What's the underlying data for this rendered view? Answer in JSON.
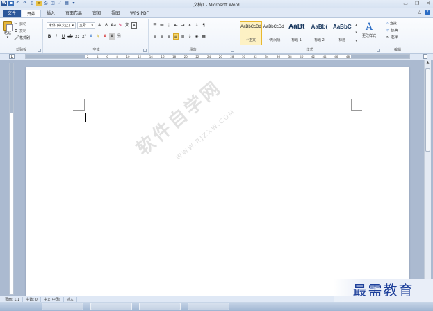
{
  "title_bar": {
    "title": "文档1 - Microsoft Word",
    "quick_access": [
      "save-icon",
      "undo-icon",
      "redo-icon",
      "new-doc-icon",
      "open-icon",
      "print-icon",
      "preview-icon",
      "spelling-icon",
      "draw-table-icon"
    ],
    "window_controls": [
      "minimize",
      "maximize",
      "close"
    ]
  },
  "tabs": [
    {
      "label": "文件"
    },
    {
      "label": "开始"
    },
    {
      "label": "插入"
    },
    {
      "label": "页面布局"
    },
    {
      "label": "审阅"
    },
    {
      "label": "视图"
    },
    {
      "label": "WPS PDF"
    }
  ],
  "clipboard": {
    "paste": "粘贴",
    "cut": "剪切",
    "copy": "复制",
    "format_painter": "格式刷",
    "label": "剪贴板"
  },
  "font": {
    "family": "宋体 (中文正)",
    "size": "五号",
    "label": "字体"
  },
  "paragraph": {
    "label": "段落"
  },
  "styles": {
    "items": [
      {
        "sample": "AaBbCcDd",
        "name": "↵正文",
        "active": true
      },
      {
        "sample": "AaBbCcDd",
        "name": "↵无间隔",
        "active": false
      },
      {
        "sample": "AaBt",
        "name": "标题 1",
        "active": false
      },
      {
        "sample": "AaBb(",
        "name": "标题 2",
        "active": false
      },
      {
        "sample": "AaBbC",
        "name": "标题",
        "active": false
      }
    ],
    "change_styles": "更改样式",
    "label": "样式"
  },
  "editing": {
    "find": "查找",
    "replace": "替换",
    "select": "选择",
    "label": "编辑"
  },
  "ruler": {
    "numbers": [
      "2",
      "4",
      "6",
      "8",
      "10",
      "12",
      "14",
      "16",
      "18",
      "20",
      "22",
      "24",
      "26",
      "28",
      "30",
      "32",
      "34",
      "36",
      "38",
      "40",
      "42",
      "44",
      "46",
      "48"
    ]
  },
  "watermark": {
    "text": "软件自学网",
    "url": "WWW.RJZXW.COM"
  },
  "statusbar": {
    "page": "页面: 1/1",
    "words": "字数: 0",
    "language": "中文(中国)",
    "mode": "插入"
  },
  "brand": "最需教育"
}
